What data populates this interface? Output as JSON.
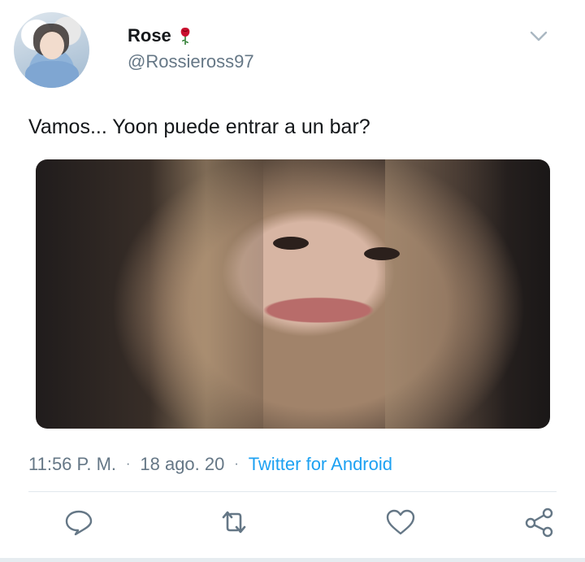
{
  "tweet": {
    "author_name": "Rose",
    "author_emoji_icon": "rose-icon",
    "handle": "@Rossieross97",
    "text": "Vamos... Yoon puede entrar a un bar?",
    "time": "11:56 P. M.",
    "date": "18 ago. 20",
    "source": "Twitter for Android",
    "separator": "·"
  },
  "actions": [
    {
      "name": "reply-button",
      "icon": "reply-icon"
    },
    {
      "name": "retweet-button",
      "icon": "retweet-icon"
    },
    {
      "name": "like-button",
      "icon": "heart-icon"
    },
    {
      "name": "share-button",
      "icon": "share-icon"
    }
  ],
  "colors": {
    "text": "#14171a",
    "secondary": "#657786",
    "link": "#1da1f2",
    "icon": "#657786",
    "rose": "#c8102e"
  }
}
